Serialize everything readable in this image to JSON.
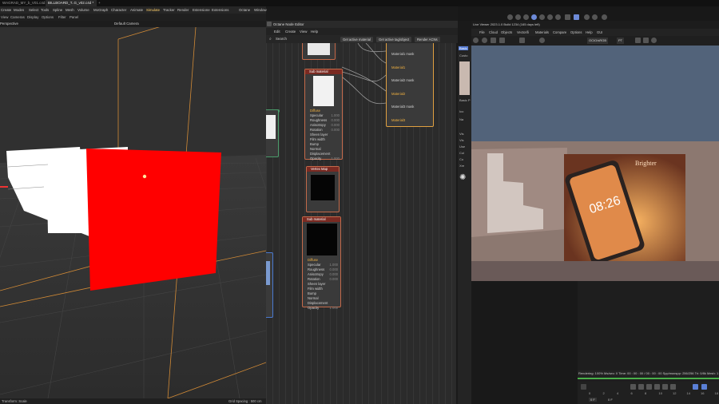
{
  "tabs": [
    {
      "label": "WAGRAD_MY_b_V01.c4d"
    },
    {
      "label": "BILLBOARD_T..G_v02.c4d *"
    },
    {
      "label": "+"
    }
  ],
  "main_menu": [
    "Create",
    "Modes",
    "Select",
    "Tools",
    "Spline",
    "Mesh",
    "Volume",
    "MoGraph",
    "Character",
    "Animate",
    "Simulate",
    "Tracker",
    "Render",
    "Extensions",
    "Extensions2",
    "Octane",
    "Window",
    "Help"
  ],
  "main_menu_alt": [
    "Create",
    "Modes",
    "Select",
    "Tools",
    "Spline",
    "Mesh",
    "Volume",
    "MoGraph",
    "Character",
    "Animate",
    "Simulate",
    "Tracker",
    "Render",
    "Estensione",
    "Extensions",
    "Octane",
    "Window",
    "Help"
  ],
  "view_menu": [
    "View",
    "Cameras",
    "Display",
    "Options",
    "Filter",
    "Panel"
  ],
  "viewport": {
    "mode_label": "Perspective",
    "camera_label": "Default Camera"
  },
  "status": {
    "left": "Transform: Scale",
    "right": "Grid Spacing : 500 cm"
  },
  "node_editor": {
    "title": "Octane Node Editor",
    "menu": [
      "Edit",
      "Create",
      "View",
      "Help"
    ],
    "search_label": "Search",
    "buttons": [
      "Get active material",
      "Get active tag/object",
      "Render ACNs"
    ],
    "mix_node": {
      "rows": [
        "Material1 mask",
        "Material1",
        "Material2 mask",
        "Material2",
        "Material3 mask",
        "Material3"
      ]
    },
    "sub_material_1": {
      "title": "Sub material",
      "rows": [
        {
          "label": "Diffuse",
          "value": ""
        },
        {
          "label": "Specular",
          "value": "1.000"
        },
        {
          "label": "Roughness",
          "value": "0.000"
        },
        {
          "label": "Anisotropy",
          "value": "0.000"
        },
        {
          "label": "Rotation",
          "value": "0.000"
        },
        {
          "label": "Sheen layer",
          "value": ""
        },
        {
          "label": "Film width",
          "value": ""
        },
        {
          "label": "Bump",
          "value": ""
        },
        {
          "label": "Normal",
          "value": ""
        },
        {
          "label": "Displacement",
          "value": ""
        },
        {
          "label": "Opacity",
          "value": "1.000"
        }
      ]
    },
    "vertex_map": {
      "title": "Vertex Map"
    },
    "sub_material_2": {
      "title": "Sub material",
      "rows": [
        {
          "label": "Diffuse",
          "value": ""
        },
        {
          "label": "Specular",
          "value": "1.000"
        },
        {
          "label": "Roughness",
          "value": "0.000"
        },
        {
          "label": "Anisotropy",
          "value": "0.000"
        },
        {
          "label": "Rotation",
          "value": "0.000"
        },
        {
          "label": "Sheen layer",
          "value": ""
        },
        {
          "label": "Film width",
          "value": ""
        },
        {
          "label": "Bump",
          "value": ""
        },
        {
          "label": "Normal",
          "value": ""
        },
        {
          "label": "Displacement",
          "value": ""
        },
        {
          "label": "Opacity",
          "value": "1.000"
        }
      ]
    }
  },
  "live_viewer": {
    "title": "Live Viewer 2023.1.0 Build 1234 (165 days left)",
    "menu": [
      "File",
      "Cloud",
      "Objects",
      "Vectorifi",
      "Materials",
      "Compare",
      "Options",
      "Help",
      "GUI"
    ],
    "color_space": "OCIO/sRGB",
    "pt_label": "PT",
    "render_text": "Brighter"
  },
  "attributes": {
    "tab": "Basic",
    "items": [
      "Custo",
      "Basic P",
      "Ico",
      "Na",
      "Vis",
      "Vis",
      "Use",
      "Col",
      "Co",
      "Xre"
    ]
  },
  "timeline": {
    "stats": "Rendering: 100%  Ms/sec: 0   Time: 00 : 00 : 00 / 00 : 00 : 00   Spp/maxspp: 256/256   Tri: 0/8k  Mesh: 1",
    "frame_current": "0 F",
    "frame_end": "0 F",
    "ruler": [
      "0",
      "2",
      "4",
      "6",
      "8",
      "10",
      "12",
      "14",
      "16",
      "18"
    ]
  },
  "colors": {
    "red_plane": "#ff0000",
    "orange_lines": "#d18a36",
    "accent": "#5a7fd6"
  }
}
